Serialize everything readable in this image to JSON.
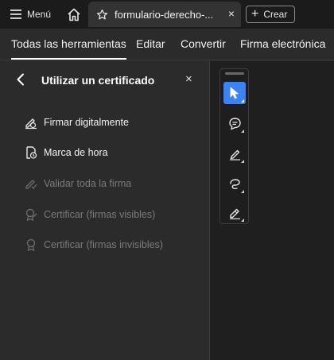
{
  "topbar": {
    "menu_label": "Menú",
    "tab_title": "formulario-derecho-...",
    "tab_close": "×",
    "create_label": "Crear"
  },
  "nav": {
    "tabs": [
      {
        "label": "Todas las herramientas",
        "active": true
      },
      {
        "label": "Editar"
      },
      {
        "label": "Convertir"
      },
      {
        "label": "Firma electrónica"
      }
    ]
  },
  "panel": {
    "title": "Utilizar un certificado",
    "close": "×",
    "items": [
      {
        "label": "Firmar digitalmente",
        "enabled": true,
        "icon": "sign-pen-icon"
      },
      {
        "label": "Marca de hora",
        "enabled": true,
        "icon": "timestamp-icon"
      },
      {
        "label": "Validar toda la firma",
        "enabled": false,
        "icon": "validate-signature-icon"
      },
      {
        "label": "Certificar (firmas visibles)",
        "enabled": false,
        "icon": "certify-visible-icon"
      },
      {
        "label": "Certificar (firmas invisibles)",
        "enabled": false,
        "icon": "certify-invisible-icon"
      }
    ]
  },
  "toolbar": {
    "tools": [
      "select-cursor-icon",
      "comment-icon",
      "highlight-pen-icon",
      "draw-lasso-icon",
      "fill-sign-icon"
    ],
    "selected": "select-cursor-icon"
  },
  "colors": {
    "accent": "#3b82f6",
    "topbar_bg": "#1b1b1b",
    "panel_bg": "#2b2b2b",
    "canvas_bg": "#1f1f1f",
    "disabled_text": "#7a7a7a"
  }
}
